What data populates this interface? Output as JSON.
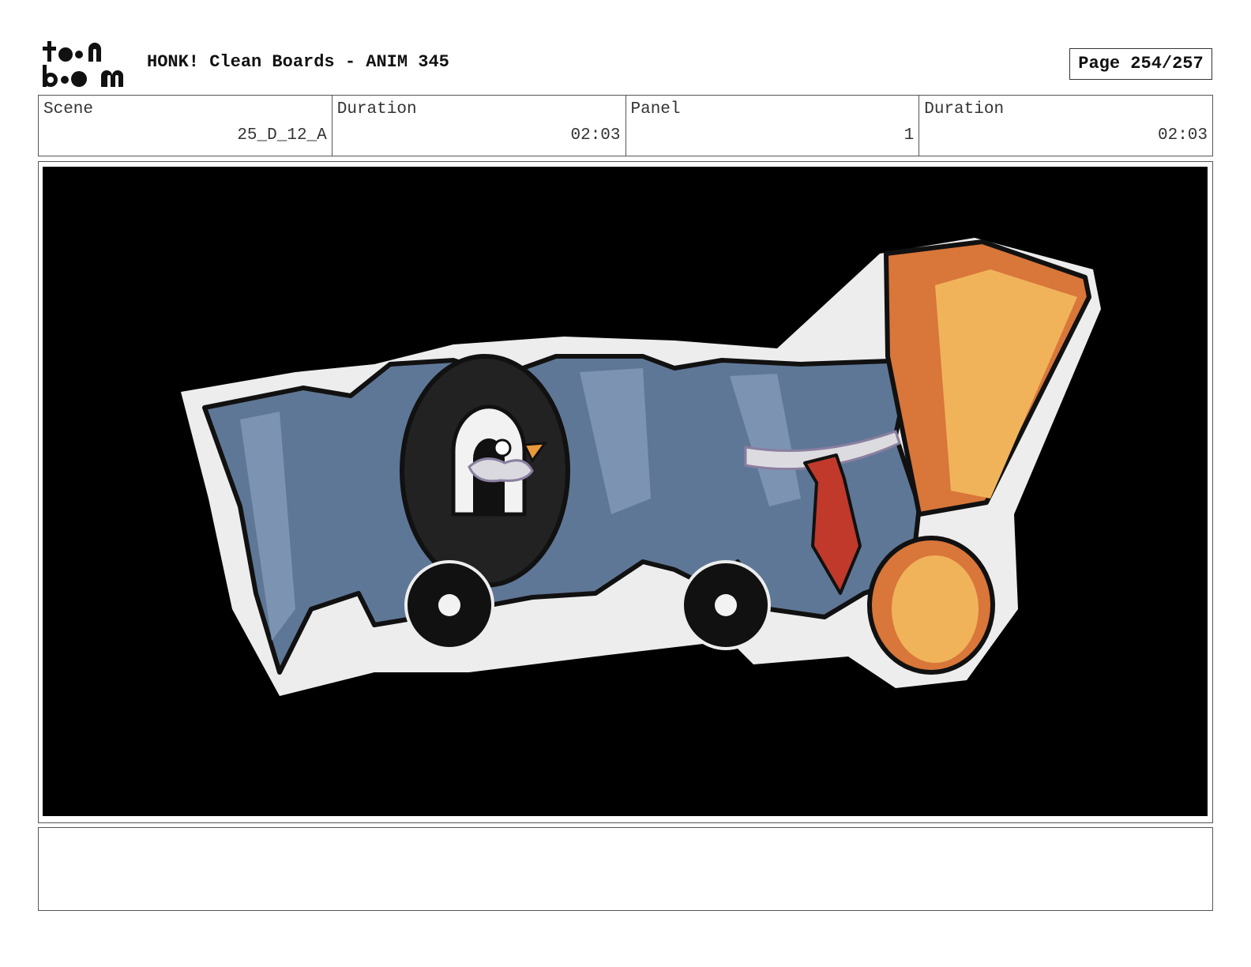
{
  "header": {
    "logo_text": "toon boom",
    "title": "HONK! Clean Boards - ANIM 345",
    "page_label": "Page 254/257"
  },
  "info": {
    "scene_label": "Scene",
    "scene_value": "25_D_12_A",
    "duration_label": "Duration",
    "duration_value": "02:03",
    "panel_label": "Panel",
    "panel_value": "1",
    "panel_duration_label": "Duration",
    "panel_duration_value": "02:03"
  },
  "panel": {
    "artwork": "HONK! title logo drawing",
    "colors": {
      "background": "#000000",
      "letters": "#5f7796",
      "outline_glow": "#efefef",
      "exclamation": "#e8a34f",
      "tie": "#c0392b"
    }
  },
  "notes": {
    "text": ""
  }
}
